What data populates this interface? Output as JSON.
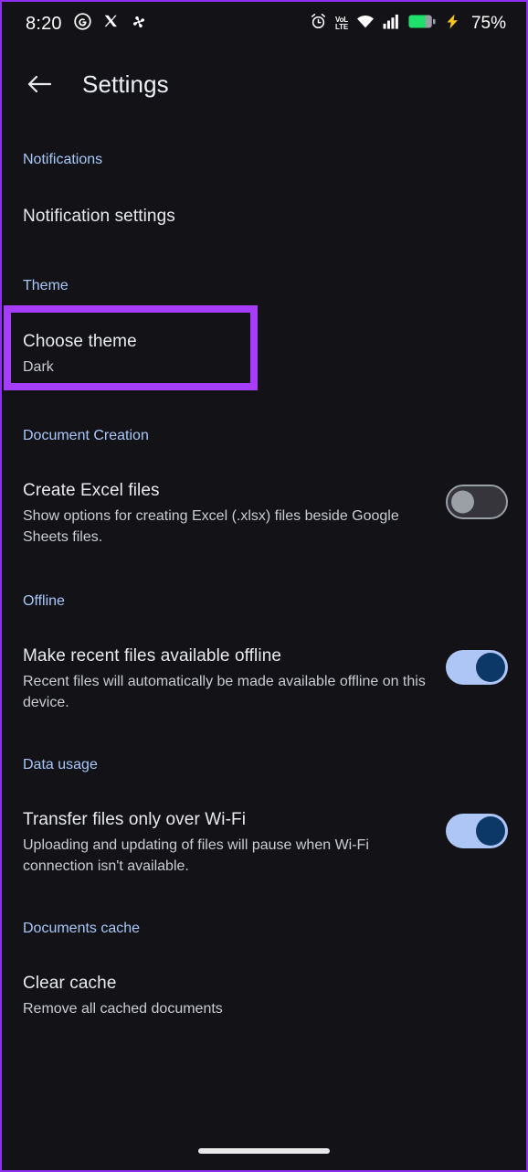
{
  "status_bar": {
    "clock": "8:20",
    "battery_percent": "75%",
    "volte_top": "VoL",
    "volte_bottom": "LTE",
    "left_icons": [
      "google-circle-icon",
      "x-twitter-icon",
      "pinwheel-icon"
    ],
    "right_icons": [
      "alarm-icon",
      "volte-icon",
      "wifi-icon",
      "signal-bars-icon",
      "battery-icon",
      "charging-bolt-icon"
    ],
    "battery_color": "#1fe06a",
    "charging_bolt_color": "#f5c518"
  },
  "app_bar": {
    "back_icon": "back-arrow-icon",
    "title": "Settings"
  },
  "colors": {
    "background": "#131317",
    "section_header": "#a8c7fa",
    "title_text": "#e8eaed",
    "subtitle_text": "#c9ccd1",
    "highlight_box": "#a53dfa",
    "toggle_on_track": "#aec6f6",
    "toggle_on_knob": "#0c3868",
    "toggle_off_track": "#35353b",
    "toggle_off_knob": "#9aa0a6"
  },
  "sections": [
    {
      "header": "Notifications",
      "rows": [
        {
          "title": "Notification settings",
          "subtitle": "",
          "control": "none"
        }
      ]
    },
    {
      "header": "Theme",
      "rows": [
        {
          "title": "Choose theme",
          "subtitle": "Dark",
          "control": "none",
          "highlighted": true
        }
      ]
    },
    {
      "header": "Document Creation",
      "rows": [
        {
          "title": "Create Excel files",
          "subtitle": "Show options for creating Excel (.xlsx) files beside Google Sheets files.",
          "control": "toggle",
          "toggle_state": "off"
        }
      ]
    },
    {
      "header": "Offline",
      "rows": [
        {
          "title": "Make recent files available offline",
          "subtitle": "Recent files will automatically be made available offline on this device.",
          "control": "toggle",
          "toggle_state": "on"
        }
      ]
    },
    {
      "header": "Data usage",
      "rows": [
        {
          "title": "Transfer files only over Wi-Fi",
          "subtitle": "Uploading and updating of files will pause when Wi-Fi connection isn't available.",
          "control": "toggle",
          "toggle_state": "on"
        }
      ]
    },
    {
      "header": "Documents cache",
      "rows": [
        {
          "title": "Clear cache",
          "subtitle": "Remove all cached documents",
          "control": "none"
        }
      ]
    }
  ]
}
